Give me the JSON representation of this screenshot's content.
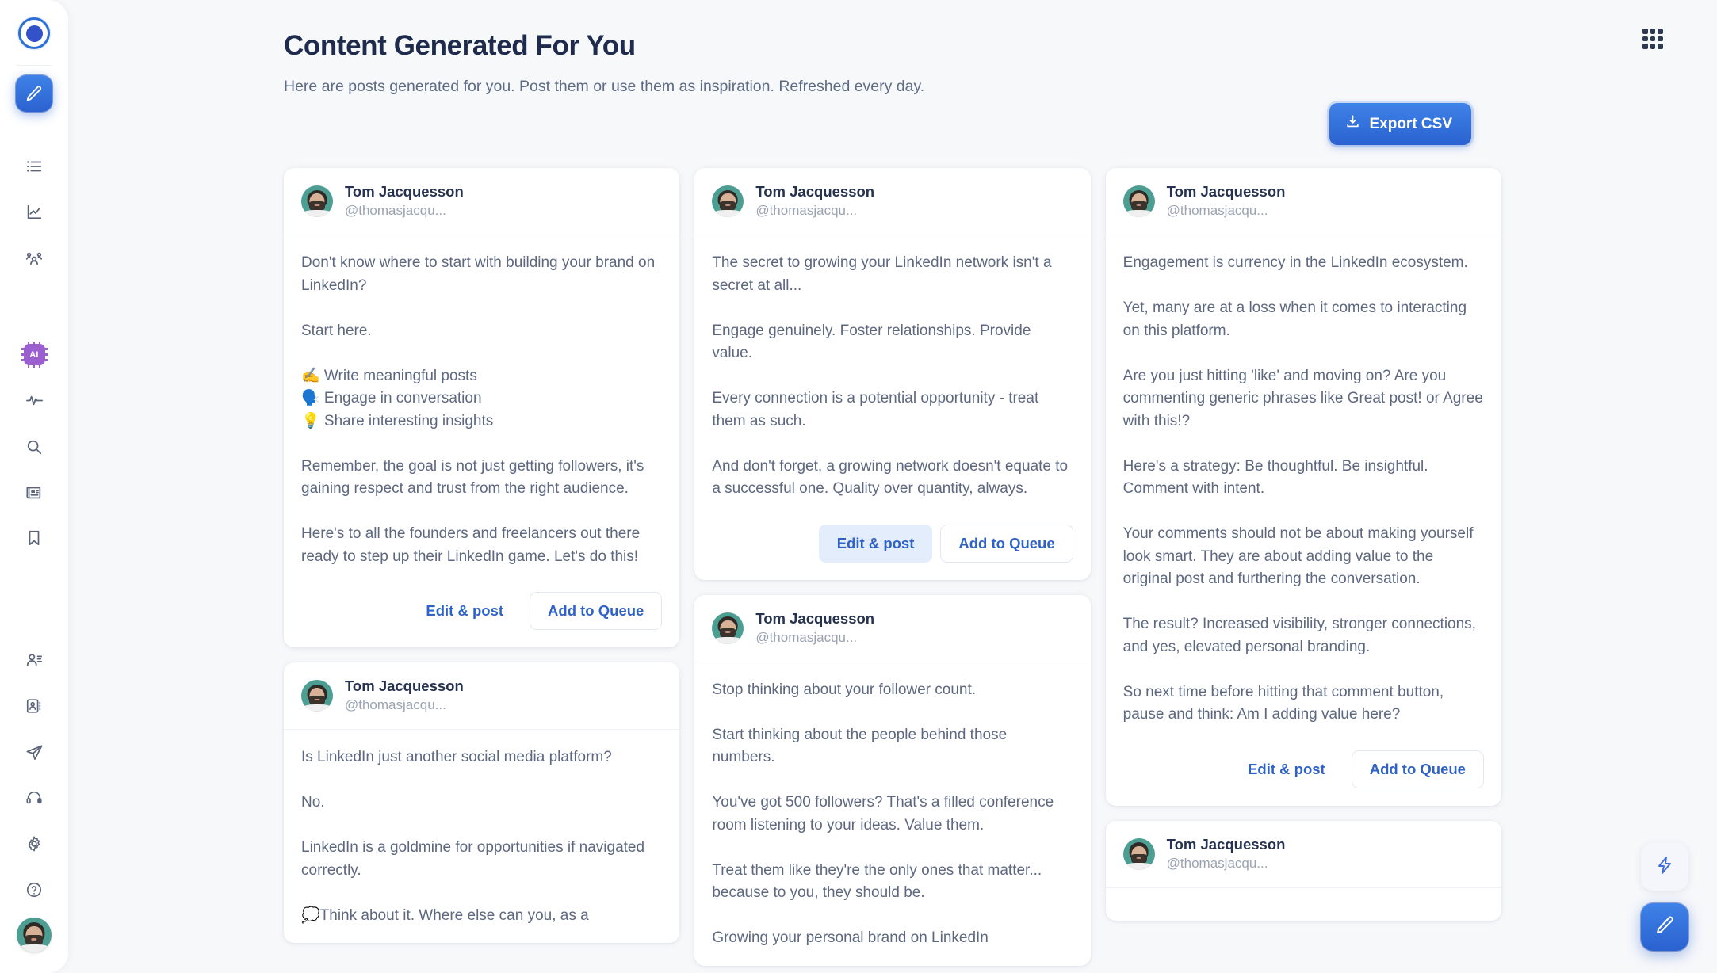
{
  "app": {
    "logo_name": "app-logo"
  },
  "sidebar": {
    "items": [
      {
        "name": "compose-pencil",
        "icon": "pencil-icon",
        "active": true
      },
      {
        "name": "list",
        "icon": "list-icon",
        "active": false
      },
      {
        "name": "analytics",
        "icon": "chart-line-icon",
        "active": false
      },
      {
        "name": "audience",
        "icon": "users-group-icon",
        "active": false
      },
      {
        "name": "ai",
        "icon": "ai-chip-icon",
        "active": false
      },
      {
        "name": "activity",
        "icon": "pulse-icon",
        "active": false
      },
      {
        "name": "search",
        "icon": "search-icon",
        "active": false
      },
      {
        "name": "news",
        "icon": "newspaper-icon",
        "active": false
      },
      {
        "name": "bookmarks",
        "icon": "bookmark-icon",
        "active": false
      },
      {
        "name": "leads",
        "icon": "user-list-icon",
        "active": false
      },
      {
        "name": "contacts",
        "icon": "contact-card-icon",
        "active": false
      },
      {
        "name": "send",
        "icon": "paper-plane-icon",
        "active": false
      },
      {
        "name": "support-headset",
        "icon": "headset-icon",
        "active": false
      },
      {
        "name": "settings",
        "icon": "gear-icon",
        "active": false
      },
      {
        "name": "help",
        "icon": "question-circle-icon",
        "active": false
      }
    ],
    "ai_badge_label": "AI"
  },
  "header": {
    "title": "Content Generated For You",
    "subtitle": "Here are posts generated for you. Post them or use them as inspiration. Refreshed every day.",
    "grid_icon": "grid-apps-icon"
  },
  "toolbar": {
    "export_label": "Export CSV",
    "export_icon": "download-icon"
  },
  "actions": {
    "edit_label": "Edit & post",
    "queue_label": "Add to Queue"
  },
  "author": {
    "name": "Tom Jacquesson",
    "handle": "@thomasjacqu..."
  },
  "fab": {
    "lightning_icon": "lightning-bolt-icon",
    "compose_icon": "pencil-icon"
  },
  "colors": {
    "accent": "#2f62c8",
    "accent_gradient_top": "#3f82e8",
    "accent_gradient_bottom": "#2a62cf",
    "title": "#1f2b4d",
    "body_text": "#5d6880",
    "muted": "#9aa3b2",
    "page_bg": "#f7f8fa",
    "card_bg": "#ffffff",
    "hover_bg": "#e3edfb",
    "ai_purple": "#9b5fd0",
    "avatar_bg": "#4c9e92"
  },
  "columns": [
    {
      "cards": [
        {
          "text": "Don't know where to start with building your brand on LinkedIn?\n\nStart here.\n\n✍️ Write meaningful posts\n🗣️ Engage in conversation\n💡 Share interesting insights\n\nRemember, the goal is not just getting followers, it's gaining respect and trust from the right audience.\n\nHere's to all the founders and freelancers out there ready to step up their LinkedIn game. Let's do this!",
          "has_actions": true,
          "edit_hovered": false
        },
        {
          "text": "Is LinkedIn just another social media platform?\n\nNo.\n\nLinkedIn is a goldmine for opportunities if navigated correctly.\n\n💭Think about it. Where else can you, as a",
          "has_actions": false,
          "edit_hovered": false
        }
      ]
    },
    {
      "cards": [
        {
          "text": "The secret to growing your LinkedIn network isn't a secret at all...\n\nEngage genuinely. Foster relationships. Provide value.\n\nEvery connection is a potential opportunity - treat them as such.\n\nAnd don't forget, a growing network doesn't equate to a successful one. Quality over quantity, always.",
          "has_actions": true,
          "edit_hovered": true
        },
        {
          "text": "Stop thinking about your follower count.\n\nStart thinking about the people behind those numbers.\n\nYou've got 500 followers? That's a filled conference room listening to your ideas. Value them.\n\nTreat them like they're the only ones that matter... because to you, they should be.\n\nGrowing your personal brand on LinkedIn",
          "has_actions": false,
          "edit_hovered": false
        }
      ]
    },
    {
      "cards": [
        {
          "text": "Engagement is currency in the LinkedIn ecosystem.\n\nYet, many are at a loss when it comes to interacting on this platform.\n\nAre you just hitting 'like' and moving on? Are you commenting generic phrases like Great post! or Agree with this!?\n\nHere's a strategy: Be thoughtful. Be insightful. Comment with intent.\n\nYour comments should not be about making yourself look smart. They are about adding value to the original post and furthering the conversation.\n\nThe result? Increased visibility, stronger connections, and yes, elevated personal branding.\n\nSo next time before hitting that comment button, pause and think: Am I adding value here?",
          "has_actions": true,
          "edit_hovered": false
        },
        {
          "text": "",
          "has_actions": false,
          "edit_hovered": false
        }
      ]
    }
  ]
}
